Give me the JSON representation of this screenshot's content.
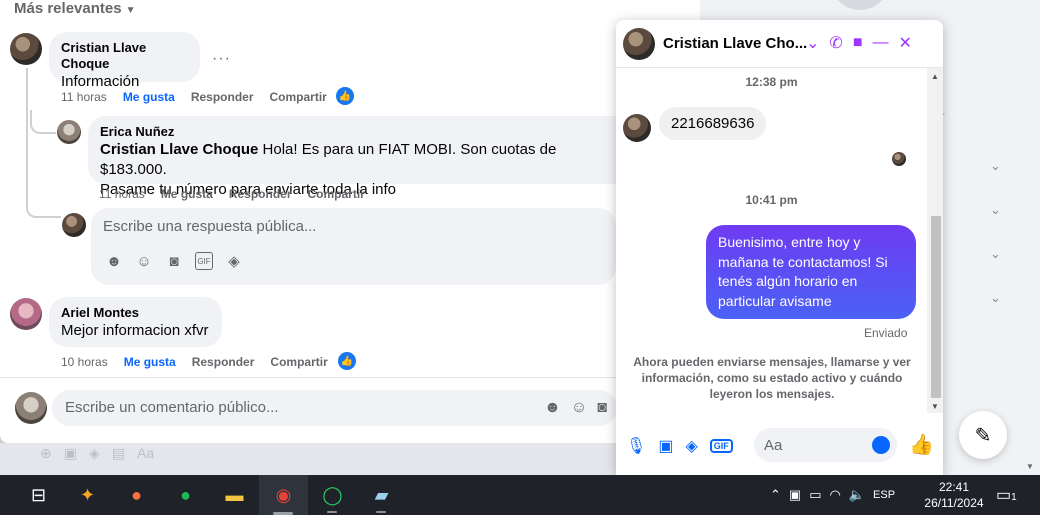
{
  "comments_panel": {
    "sort_label": "Más relevantes",
    "comments": [
      {
        "author": "Cristian Llave Choque",
        "text": "Información",
        "time": "11 horas",
        "like_label": "Me gusta",
        "reply_label": "Responder",
        "share_label": "Compartir"
      },
      {
        "author": "Ariel Montes",
        "text": "Mejor informacion xfvr",
        "time": "10 horas",
        "like_label": "Me gusta",
        "reply_label": "Responder",
        "share_label": "Compartir"
      }
    ],
    "reply": {
      "author": "Erica Nuñez",
      "mention": "Cristian Llave Choque",
      "text_line1": " Hola! Es para un FIAT MOBI. Son cuotas de $183.000.",
      "text_line2": "Pasame tu número para enviarte toda la info",
      "time": "11 horas",
      "like_label": "Me gusta",
      "reply_label": "Responder",
      "share_label": "Compartir"
    },
    "reply_input_placeholder": "Escribe una respuesta pública...",
    "comment_input_placeholder": "Escribe un comentario público..."
  },
  "chat": {
    "title": "Cristian Llave Cho...",
    "timestamp1": "12:38 pm",
    "incoming_message": "2216689636",
    "timestamp2": "10:41 pm",
    "outgoing_message": "Buenisimo, entre hoy y mañana te contactamos! Si tenés algún horario en particular avisame",
    "status": "Enviado",
    "notice": "Ahora pueden enviarse mensajes, llamarse y ver información, como su estado activo y cuándo leyeron los mensajes.",
    "input_placeholder": "Aa",
    "accent_color": "#0866ff"
  },
  "background": {
    "faded_input_placeholder": "Aa"
  },
  "taskbar": {
    "language": "ESP",
    "time": "22:41",
    "date": "26/11/2024",
    "notification_count": "1"
  }
}
